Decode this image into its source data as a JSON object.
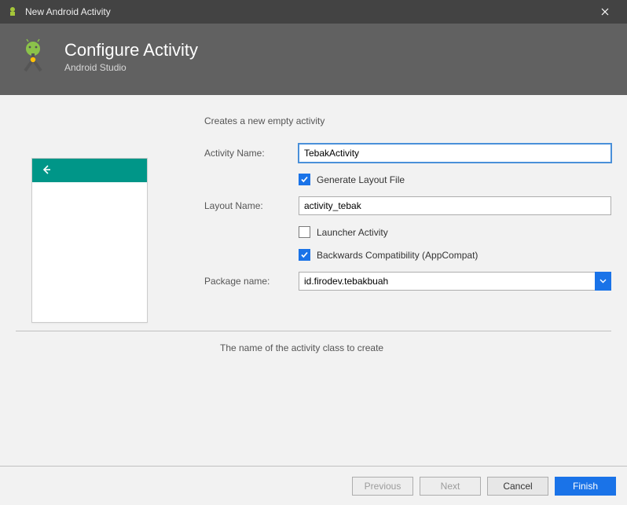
{
  "window": {
    "title": "New Android Activity"
  },
  "header": {
    "title": "Configure Activity",
    "subtitle": "Android Studio"
  },
  "form": {
    "intro": "Creates a new empty activity",
    "activityName": {
      "label": "Activity Name:",
      "value": "TebakActivity"
    },
    "generateLayout": {
      "label": "Generate Layout File",
      "checked": true
    },
    "layoutName": {
      "label": "Layout Name:",
      "value": "activity_tebak"
    },
    "launcherActivity": {
      "label": "Launcher Activity",
      "checked": false
    },
    "backwardsCompat": {
      "label": "Backwards Compatibility (AppCompat)",
      "checked": true
    },
    "packageName": {
      "label": "Package name:",
      "value": "id.firodev.tebakbuah"
    },
    "helpText": "The name of the activity class to create"
  },
  "footer": {
    "previous": "Previous",
    "next": "Next",
    "cancel": "Cancel",
    "finish": "Finish"
  }
}
